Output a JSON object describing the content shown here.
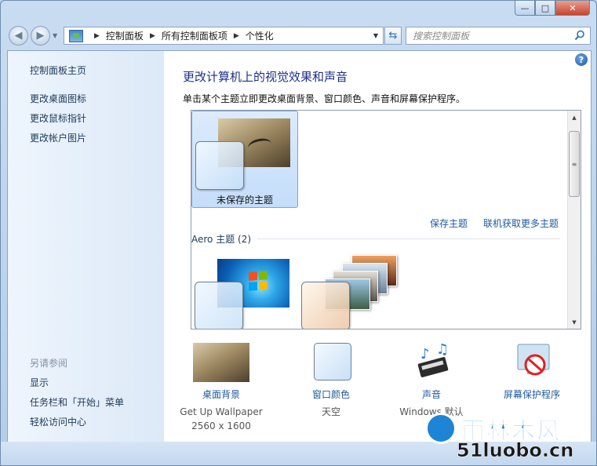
{
  "window": {
    "caption": {
      "minimize": "—",
      "maximize": "□",
      "close": "✕"
    }
  },
  "nav": {
    "back": "◀",
    "forward": "▶",
    "breadcrumb": [
      "控制面板",
      "所有控制面板项",
      "个性化"
    ],
    "search_placeholder": "搜索控制面板"
  },
  "sidebar": {
    "home": "控制面板主页",
    "links": [
      "更改桌面图标",
      "更改鼠标指针",
      "更改帐户图片"
    ],
    "see_also_heading": "另请参阅",
    "see_also": [
      "显示",
      "任务栏和「开始」菜单",
      "轻松访问中心"
    ]
  },
  "main": {
    "help": "?",
    "title": "更改计算机上的视觉效果和声音",
    "subtitle": "单击某个主题立即更改桌面背景、窗口颜色、声音和屏幕保护程序。",
    "themes": {
      "unsaved_label": "未保存的主题",
      "save_link": "保存主题",
      "online_link": "联机获取更多主题",
      "aero_group": "Aero 主题 (2)"
    },
    "options": [
      {
        "label": "桌面背景",
        "detail": [
          "Get Up Wallpaper",
          "2560 x 1600"
        ]
      },
      {
        "label": "窗口颜色",
        "detail": [
          "天空"
        ]
      },
      {
        "label": "声音",
        "detail": [
          "Windows 默认"
        ]
      },
      {
        "label": "屏幕保护程序",
        "detail": []
      }
    ]
  },
  "watermark": {
    "brand": "雨林木风",
    "url": "51luobo.cn"
  },
  "colors": {
    "link": "#1e5aa0",
    "title": "#1e3287",
    "sidebar_bg": "#dce9f7"
  }
}
